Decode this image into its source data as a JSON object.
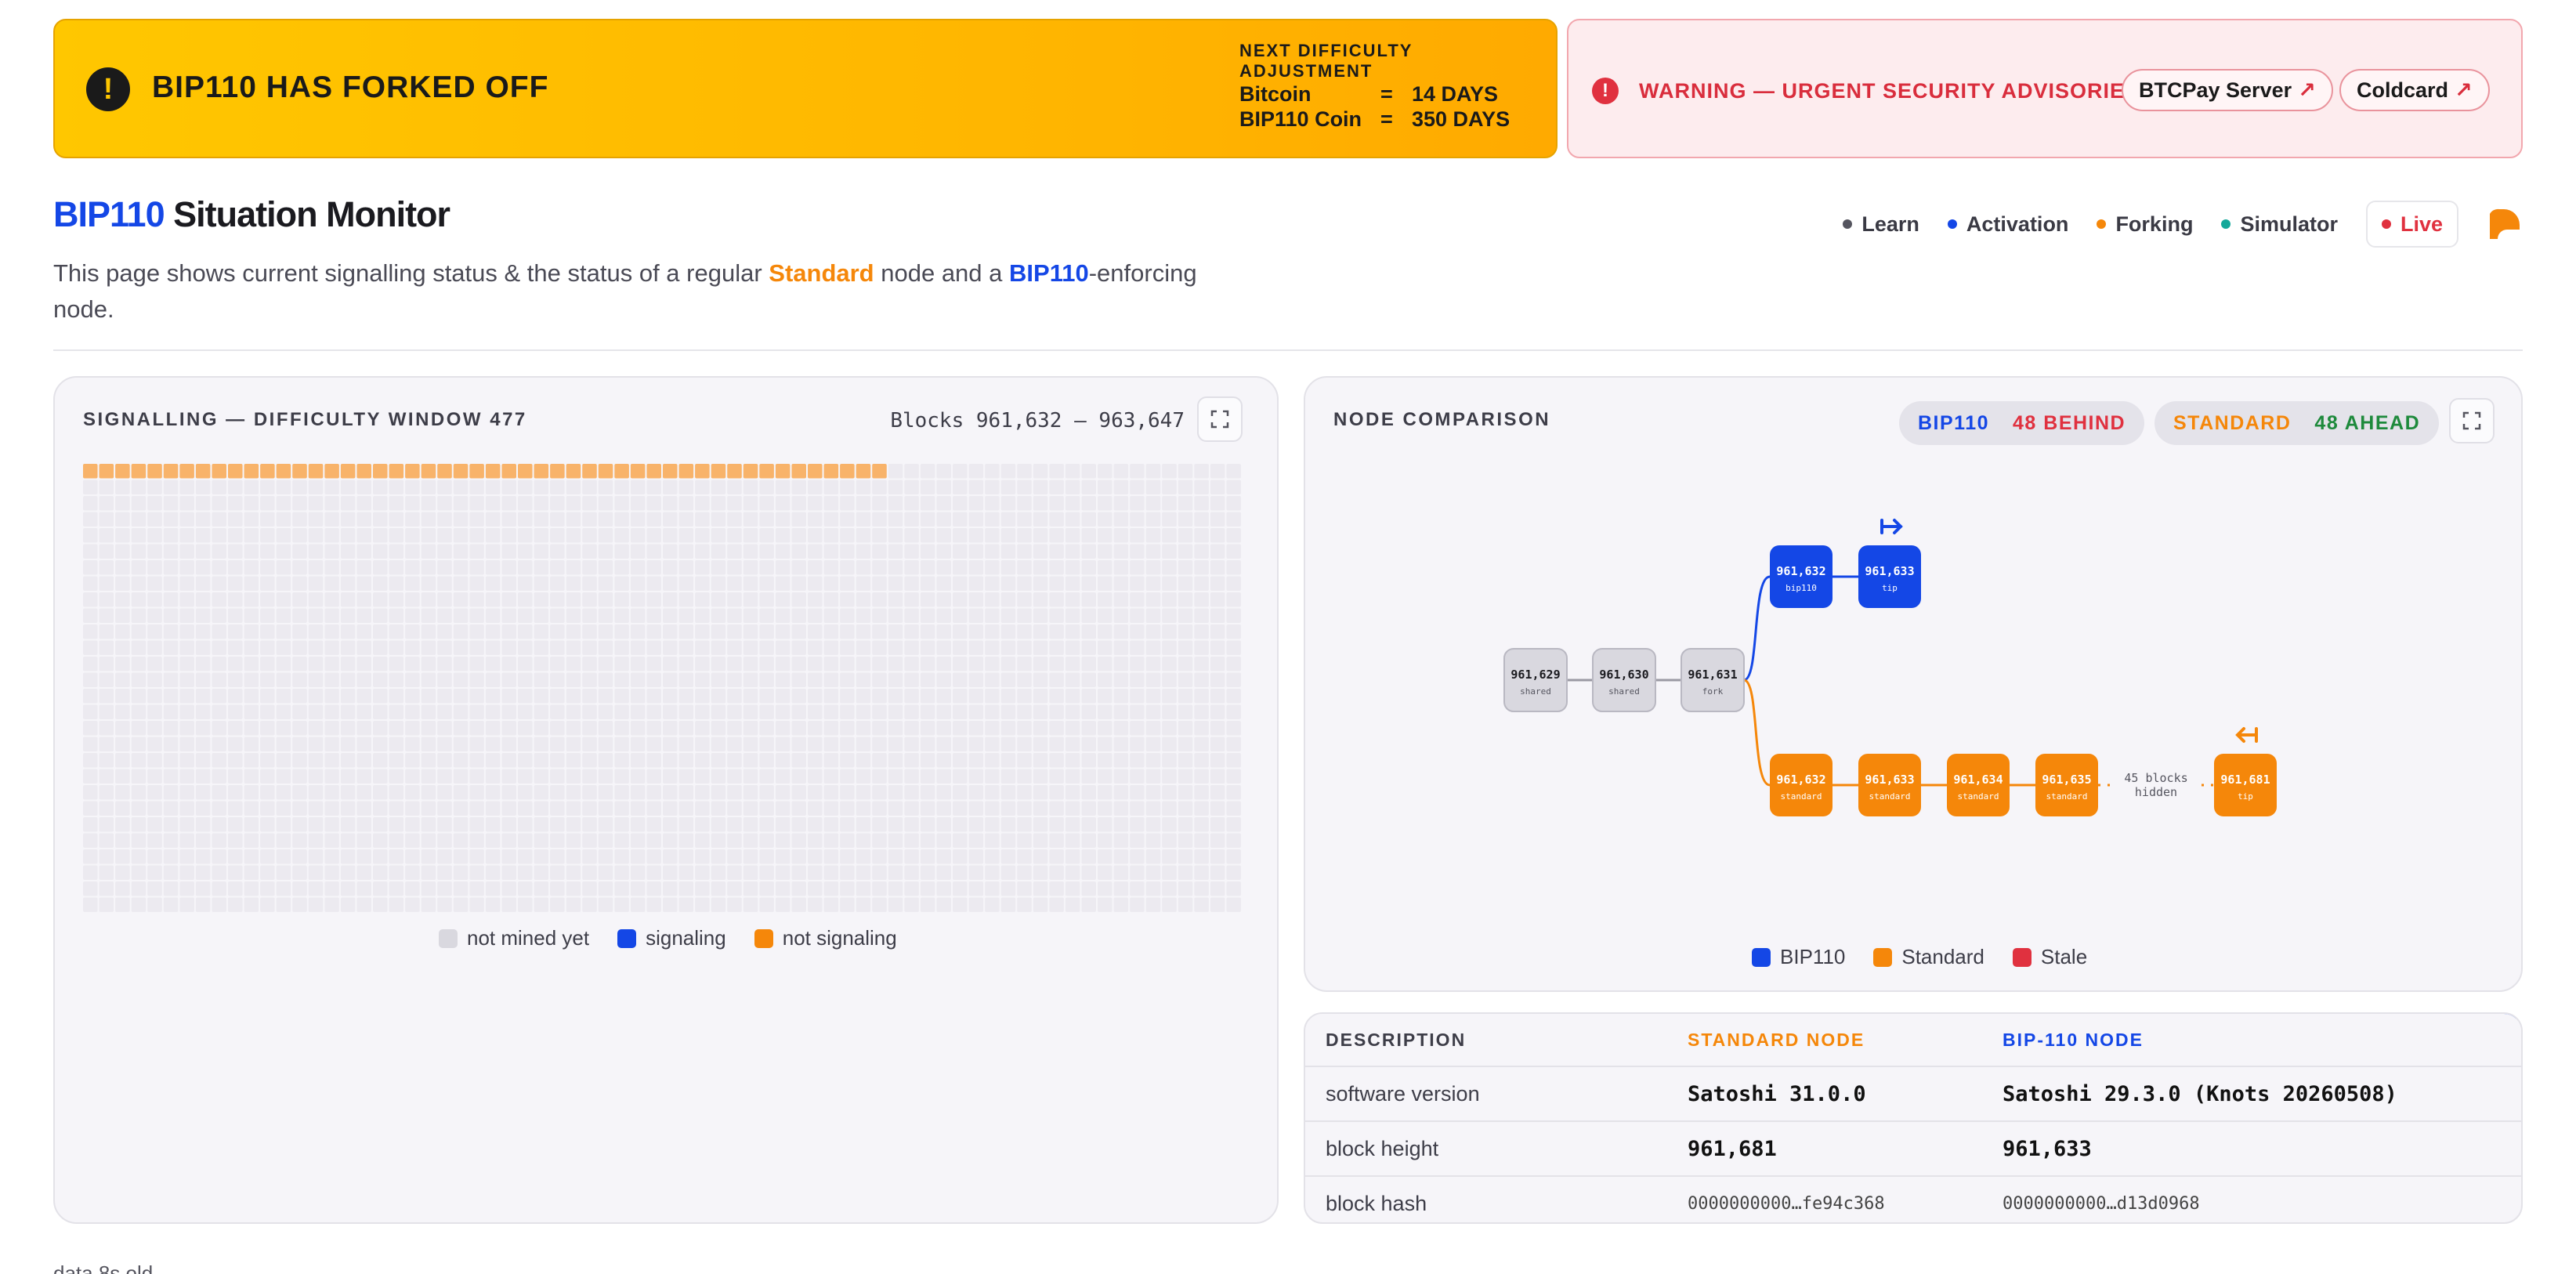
{
  "fork_banner": {
    "title": "BIP110 HAS FORKED OFF",
    "difficulty_heading": "NEXT DIFFICULTY ADJUSTMENT",
    "rows": [
      {
        "chain": "Bitcoin",
        "value": "14 DAYS"
      },
      {
        "chain": "BIP110 Coin",
        "value": "350 DAYS"
      }
    ],
    "equals": "="
  },
  "warning_banner": {
    "text": "WARNING — URGENT SECURITY ADVISORIES",
    "links": [
      {
        "label": "BTCPay Server"
      },
      {
        "label": "Coldcard"
      }
    ],
    "link_arrow": "↗"
  },
  "header": {
    "title_bip": "BIP110",
    "title_rest": " Situation Monitor",
    "intro_1": "This page shows current signalling status & the status of a regular ",
    "intro_std": "Standard",
    "intro_2": " node and a ",
    "intro_bip": "BIP110",
    "intro_3": "-enforcing node."
  },
  "nav": {
    "items": [
      {
        "label": "Learn",
        "color": "#55555f"
      },
      {
        "label": "Activation",
        "color": "#1447e6"
      },
      {
        "label": "Forking",
        "color": "#f5870a"
      },
      {
        "label": "Simulator",
        "color": "#14a89a"
      }
    ],
    "live": {
      "label": "Live",
      "color": "#e0313f"
    },
    "logo_icon": "brand-logo-icon"
  },
  "signalling": {
    "title": "SIGNALLING — DIFFICULTY WINDOW 477",
    "range": "Blocks 961,632 – 963,647",
    "window_blocks": 2016,
    "mined_blocks": 50,
    "signaling_blocks": 0,
    "colors": {
      "not_mined": "#eceaf0",
      "signaling": "#1447e6",
      "not_signaling": "#f8b36a"
    },
    "legend": [
      "not mined yet",
      "signaling",
      "not signaling"
    ],
    "legend_colors": [
      "#d9d8df",
      "#1447e6",
      "#f5870a"
    ]
  },
  "node_comparison": {
    "title": "NODE COMPARISON",
    "bip_badge": {
      "label": "BIP110",
      "status": "48 BEHIND"
    },
    "std_badge": {
      "label": "STANDARD",
      "status": "48 AHEAD"
    },
    "shared_blocks": [
      {
        "height": "961,629",
        "tag": "shared"
      },
      {
        "height": "961,630",
        "tag": "shared"
      },
      {
        "height": "961,631",
        "tag": "fork"
      }
    ],
    "bip_blocks": [
      {
        "height": "961,632",
        "tag": "bip110"
      },
      {
        "height": "961,633",
        "tag": "tip"
      }
    ],
    "std_blocks": [
      {
        "height": "961,632",
        "tag": "standard"
      },
      {
        "height": "961,633",
        "tag": "standard"
      },
      {
        "height": "961,634",
        "tag": "standard"
      },
      {
        "height": "961,635",
        "tag": "standard"
      },
      {
        "height": "961,681",
        "tag": "tip"
      }
    ],
    "hidden_note": [
      "45 blocks",
      "hidden"
    ],
    "colors": {
      "bip110": "#1447e6",
      "standard": "#f5870a",
      "stale": "#e0313f",
      "shared": "#d9d8df"
    },
    "legend": [
      "BIP110",
      "Standard",
      "Stale"
    ]
  },
  "table": {
    "headers": [
      "DESCRIPTION",
      "STANDARD NODE",
      "BIP-110 NODE"
    ],
    "rows": [
      {
        "label": "software version",
        "standard": "Satoshi 31.0.0",
        "bip110": "Satoshi 29.3.0 (Knots 20260508)"
      },
      {
        "label": "block height",
        "standard": "961,681",
        "bip110": "961,633"
      },
      {
        "label": "block hash",
        "standard": "0000000000…fe94c368",
        "bip110": "0000000000…d13d0968"
      }
    ]
  },
  "footer": {
    "note": "data 8s old"
  }
}
